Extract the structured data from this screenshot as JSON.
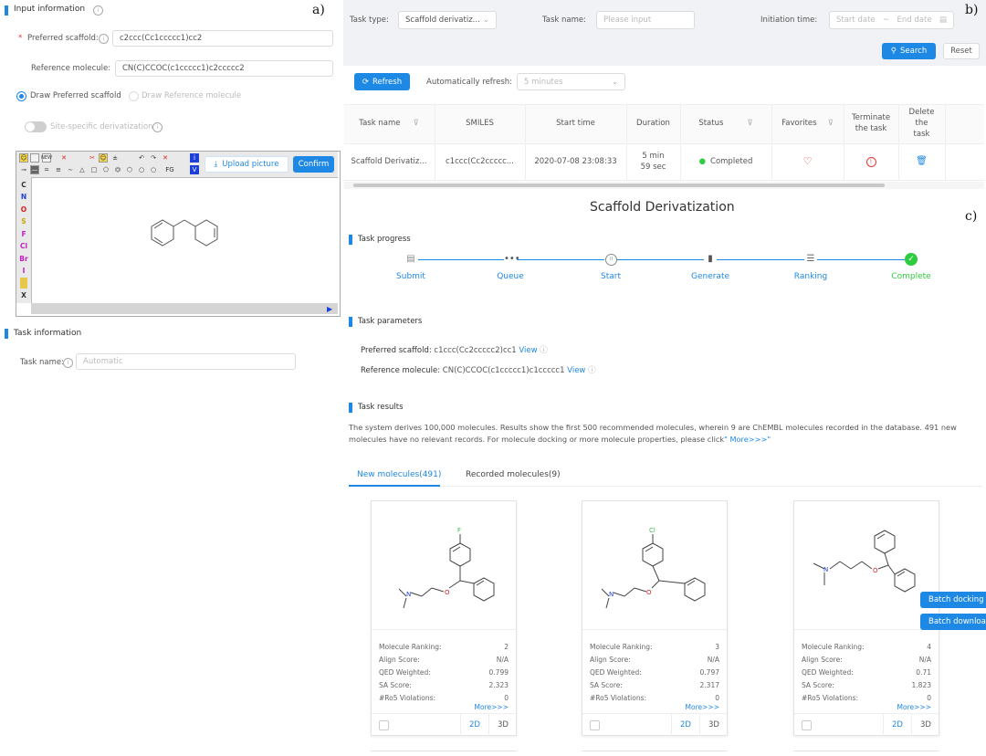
{
  "panel_a": {
    "letter": "a)",
    "input_section_title": "Input information",
    "preferred_scaffold_label": "Preferred scaffold:",
    "preferred_scaffold_value": "c2ccc(Cc1ccccc1)cc2",
    "reference_molecule_label": "Reference molecule:",
    "reference_molecule_value": "CN(C)CCOC(c1ccccc1)c2ccccc2",
    "radio_preferred": "Draw Preferred scaffold",
    "radio_reference": "Draw Reference molecule",
    "toggle_label": "Site-specific derivatization",
    "upload_button": "Upload picture",
    "confirm_button": "Confirm",
    "element_buttons": [
      "C",
      "N",
      "O",
      "S",
      "F",
      "Cl",
      "Br",
      "I",
      "",
      "X"
    ],
    "element_colors": [
      "#333333",
      "#1e3fd8",
      "#d81e1e",
      "#c8a800",
      "#c020c0",
      "#c020c0",
      "#c020c0",
      "#c020c0",
      "#c8a800",
      "#333333"
    ],
    "toolbar_fg": "FG",
    "task_section_title": "Task information",
    "task_name_label": "Task name:",
    "task_name_placeholder": "Automatic"
  },
  "panel_b": {
    "letter": "b)",
    "task_type_label": "Task type:",
    "task_type_value": "Scaffold derivatiz...",
    "task_name_label": "Task name:",
    "task_name_placeholder": "Please input",
    "initiation_label": "Initiation time:",
    "start_date_placeholder": "Start date",
    "date_separator": "~",
    "end_date_placeholder": "End date",
    "search_button": "Search",
    "reset_button": "Reset",
    "refresh_button": "Refresh",
    "auto_refresh_label": "Automatically refresh:",
    "auto_refresh_value": "5 minutes",
    "table": {
      "headers": [
        "Task name",
        "SMILES",
        "Start time",
        "Duration",
        "Status",
        "Favorites",
        "Terminate the task",
        "Delete the task"
      ],
      "row": {
        "task_name": "Scaffold Derivatiz...",
        "smiles": "c1ccc(Cc2ccccc...",
        "start_time": "2020-07-08 23:08:33",
        "duration": "5 min 59 sec",
        "status": "Completed"
      }
    }
  },
  "panel_c": {
    "letter": "c)",
    "title": "Scaffold Derivatization",
    "task_progress_title": "Task progress",
    "steps": [
      "Submit",
      "Queue",
      "Start",
      "Generate",
      "Ranking",
      "Complete"
    ],
    "task_parameters_title": "Task parameters",
    "param_scaffold_label": "Preferred scaffold:",
    "param_scaffold_value": "c1ccc(Cc2ccccc2)cc1",
    "param_reference_label": "Reference molecule:",
    "param_reference_value": "CN(C)CCOC(c1ccccc1)c1ccccc1",
    "view_link": "View",
    "task_results_title": "Task results",
    "results_text": "The system derives 100,000 molecules. Results show the first 500 recommended molecules, wherein 9 are ChEMBL molecules recorded in the database. 491 new molecules have no relevant records. For molecule docking or more molecule properties, please click",
    "results_more": "\" More>>>\"",
    "tab_new": "New molecules(491)",
    "tab_recorded": "Recorded molecules(9)",
    "stat_labels": [
      "Molecule Ranking:",
      "Align Score:",
      "QED Weighted:",
      "SA Score:",
      "#Ro5 Violations:"
    ],
    "cards": [
      {
        "atom_label": "F",
        "atom_color": "#3fb950",
        "values": [
          "2",
          "N/A",
          "0.799",
          "2.323",
          "0"
        ]
      },
      {
        "atom_label": "Cl",
        "atom_color": "#3fb950",
        "values": [
          "3",
          "N/A",
          "0.797",
          "2.317",
          "0"
        ]
      },
      {
        "atom_label": "",
        "atom_color": "#333333",
        "values": [
          "4",
          "N/A",
          "0.71",
          "1.823",
          "0"
        ]
      }
    ],
    "more_link": "More>>>",
    "btn_2d": "2D",
    "btn_3d": "3D",
    "batch_docking": "Batch docking",
    "batch_download": "Batch downloa"
  },
  "colors": {
    "accent": "#1e88e5",
    "success": "#2ecc40",
    "danger": "#e53935",
    "nitrogen": "#1e3fd8",
    "oxygen": "#d81e1e"
  }
}
